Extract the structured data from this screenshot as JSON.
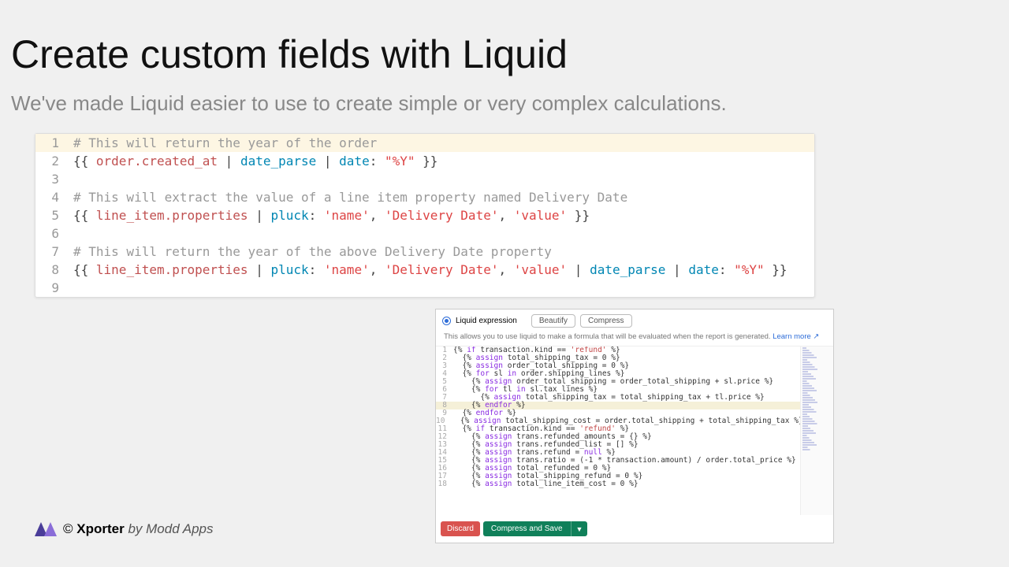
{
  "title": "Create custom fields with Liquid",
  "subtitle": "We've made Liquid easier to use to create simple or very complex calculations.",
  "code": {
    "lines": [
      {
        "n": 1,
        "tokens": [
          [
            "comment",
            "# This will return the year of the order"
          ]
        ]
      },
      {
        "n": 2,
        "tokens": [
          [
            "bracket",
            "{{ "
          ],
          [
            "var",
            "order.created_at"
          ],
          [
            "punct",
            " | "
          ],
          [
            "filter",
            "date_parse"
          ],
          [
            "punct",
            " | "
          ],
          [
            "filter",
            "date"
          ],
          [
            "punct",
            ": "
          ],
          [
            "str",
            "\"%Y\""
          ],
          [
            "bracket",
            " }}"
          ]
        ]
      },
      {
        "n": 3,
        "tokens": []
      },
      {
        "n": 4,
        "tokens": [
          [
            "comment",
            "# This will extract the value of a line item property named Delivery Date"
          ]
        ]
      },
      {
        "n": 5,
        "tokens": [
          [
            "bracket",
            "{{ "
          ],
          [
            "var",
            "line_item.properties"
          ],
          [
            "punct",
            " | "
          ],
          [
            "filter",
            "pluck"
          ],
          [
            "punct",
            ": "
          ],
          [
            "str",
            "'name'"
          ],
          [
            "punct",
            ", "
          ],
          [
            "str",
            "'Delivery Date'"
          ],
          [
            "punct",
            ", "
          ],
          [
            "str",
            "'value'"
          ],
          [
            "bracket",
            " }}"
          ]
        ]
      },
      {
        "n": 6,
        "tokens": []
      },
      {
        "n": 7,
        "tokens": [
          [
            "comment",
            "# This will return the year of the above Delivery Date property"
          ]
        ]
      },
      {
        "n": 8,
        "tokens": [
          [
            "bracket",
            "{{ "
          ],
          [
            "var",
            "line_item.properties"
          ],
          [
            "punct",
            " | "
          ],
          [
            "filter",
            "pluck"
          ],
          [
            "punct",
            ": "
          ],
          [
            "str",
            "'name'"
          ],
          [
            "punct",
            ", "
          ],
          [
            "str",
            "'Delivery Date'"
          ],
          [
            "punct",
            ", "
          ],
          [
            "str",
            "'value'"
          ],
          [
            "punct",
            " | "
          ],
          [
            "filter",
            "date_parse"
          ],
          [
            "punct",
            " | "
          ],
          [
            "filter",
            "date"
          ],
          [
            "punct",
            ": "
          ],
          [
            "str",
            "\"%Y\""
          ],
          [
            "bracket",
            " }}"
          ]
        ]
      },
      {
        "n": 9,
        "tokens": []
      }
    ]
  },
  "panel": {
    "radio_label": "Liquid expression",
    "beautify": "Beautify",
    "compress": "Compress",
    "desc_pre": "This allows you to use liquid to make a formula that will be evaluated when the report is generated. ",
    "learn_more": "Learn more",
    "learn_icon": "↗",
    "discard": "Discard",
    "save": "Compress and Save",
    "save_drop": "▼",
    "editor_lines": [
      {
        "n": 1,
        "hl": false,
        "raw": "{% if transaction.kind == 'refund' %}"
      },
      {
        "n": 2,
        "hl": false,
        "raw": "  {% assign total_shipping_tax = 0 %}"
      },
      {
        "n": 3,
        "hl": false,
        "raw": "  {% assign order_total_shipping = 0 %}"
      },
      {
        "n": 4,
        "hl": false,
        "raw": "  {% for sl in order.shipping_lines %}"
      },
      {
        "n": 5,
        "hl": false,
        "raw": "    {% assign order_total_shipping = order_total_shipping + sl.price %}"
      },
      {
        "n": 6,
        "hl": false,
        "raw": "    {% for tl in sl.tax_lines %}"
      },
      {
        "n": 7,
        "hl": false,
        "raw": "      {% assign total_shipping_tax = total_shipping_tax + tl.price %}"
      },
      {
        "n": 8,
        "hl": true,
        "raw": "    {% endfor %}"
      },
      {
        "n": 9,
        "hl": false,
        "raw": "  {% endfor %}"
      },
      {
        "n": 10,
        "hl": false,
        "raw": "  {% assign total_shipping_cost = order.total_shipping + total_shipping_tax %}"
      },
      {
        "n": 11,
        "hl": false,
        "raw": "  {% if transaction.kind == 'refund' %}"
      },
      {
        "n": 12,
        "hl": false,
        "raw": "    {% assign trans.refunded_amounts = {} %}"
      },
      {
        "n": 13,
        "hl": false,
        "raw": "    {% assign trans.refunded_list = [] %}"
      },
      {
        "n": 14,
        "hl": false,
        "raw": "    {% assign trans.refund = null %}"
      },
      {
        "n": 15,
        "hl": false,
        "raw": "    {% assign trans.ratio = (-1 * transaction.amount) / order.total_price %}"
      },
      {
        "n": 16,
        "hl": false,
        "raw": "    {% assign total_refunded = 0 %}"
      },
      {
        "n": 17,
        "hl": false,
        "raw": "    {% assign total_shipping_refund = 0 %}"
      },
      {
        "n": 18,
        "hl": false,
        "raw": "    {% assign total_line_item_cost = 0 %}"
      }
    ]
  },
  "footer": {
    "copyright": "©",
    "product": "Xporter",
    "by": "by Modd Apps"
  }
}
